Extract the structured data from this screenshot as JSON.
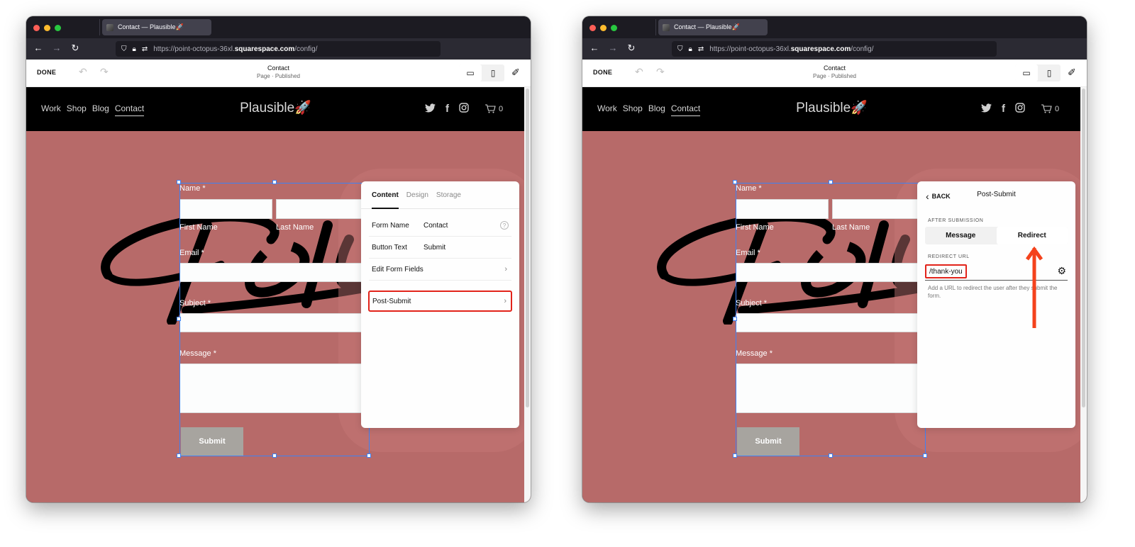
{
  "browser": {
    "tab_title": "Contact — Plausible🚀",
    "url_prefix": "https://point-octopus-36xl.",
    "url_domain": "squarespace.com",
    "url_path": "/config/",
    "icons": {
      "back": "←",
      "forward": "→",
      "reload": "↻",
      "shield": "⛉",
      "lock": "🔒",
      "permissions": "⇄"
    }
  },
  "editor": {
    "done_label": "DONE",
    "undo_icon": "↶",
    "redo_icon": "↷",
    "page_title": "Contact",
    "page_status": "Page · Published",
    "desktop_icon": "🖵",
    "mobile_icon": "▯",
    "design_icon": "🖌"
  },
  "site": {
    "nav": [
      "Work",
      "Shop",
      "Blog",
      "Contact"
    ],
    "active_nav": "Contact",
    "logo": "Plausible🚀",
    "social": {
      "twitter": "🐦",
      "facebook": "f",
      "instagram": "◎"
    },
    "cart_icon": "🛒",
    "cart_count": "0"
  },
  "form": {
    "name_label": "Name *",
    "first_name_label": "First Name",
    "last_name_label": "Last Name",
    "email_label": "Email *",
    "subject_label": "Subject *",
    "message_label": "Message *",
    "submit_label": "Submit"
  },
  "panel_content": {
    "tabs": [
      "Content",
      "Design",
      "Storage"
    ],
    "active_tab": "Content",
    "rows": [
      {
        "label": "Form Name",
        "value": "Contact"
      },
      {
        "label": "Button Text",
        "value": "Submit"
      },
      {
        "label": "Edit Form Fields",
        "value": ""
      },
      {
        "label": "Post-Submit",
        "value": ""
      }
    ],
    "help_icon": "?",
    "chevron": "›"
  },
  "panel_post_submit": {
    "back_label": "BACK",
    "back_icon": "‹",
    "title": "Post-Submit",
    "after_submission_label": "AFTER SUBMISSION",
    "options": [
      "Message",
      "Redirect"
    ],
    "selected_option": "Redirect",
    "redirect_url_label": "REDIRECT URL",
    "redirect_url_value": "/thank-you",
    "gear_icon": "⚙",
    "hint": "Add a URL to redirect the user after they submit the form."
  },
  "annotation_colors": {
    "highlight_box": "#e2231a",
    "arrow": "#f4421c",
    "selection": "#3d82f5"
  }
}
